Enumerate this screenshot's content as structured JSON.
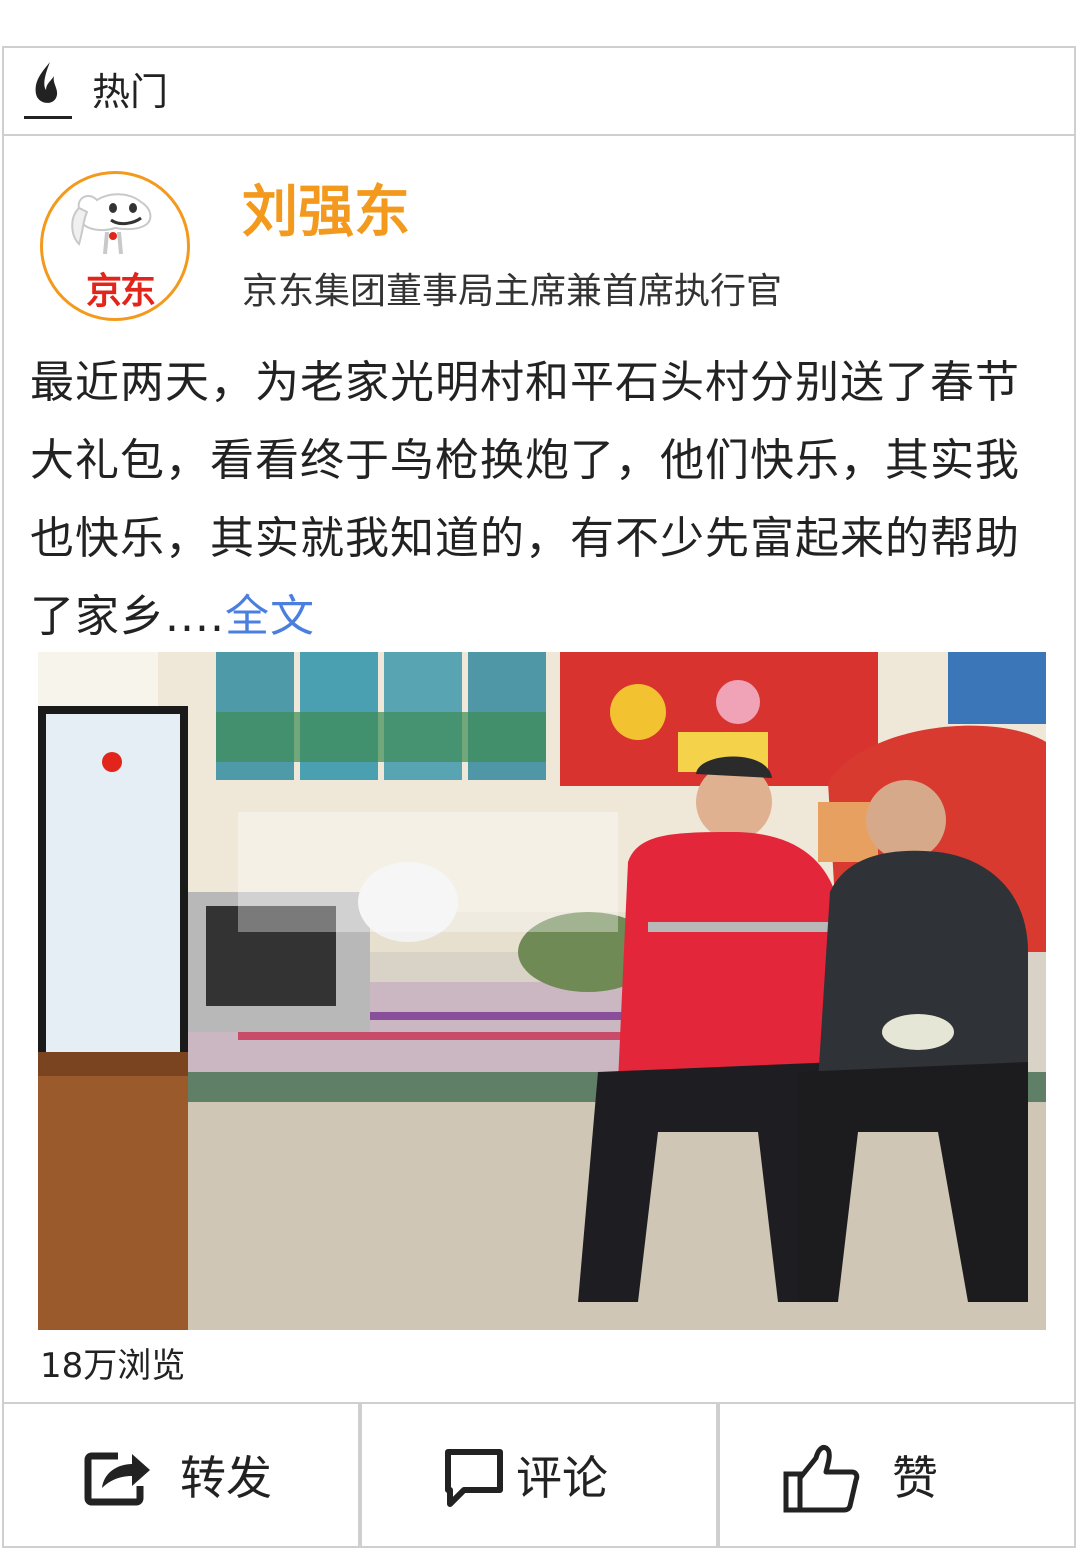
{
  "section": {
    "label": "热门",
    "icon": "flame-icon"
  },
  "post": {
    "author": {
      "name": "刘强东",
      "title": "京东集团董事局主席兼首席执行官",
      "avatar_text": "京东"
    },
    "text": "最近两天，为老家光明村和平石头村分别送了春节大礼包，看看终于鸟枪换炮了，他们快乐，其实我也快乐，其实就我知道的，有不少先富起来的帮助了家乡....",
    "full_link": "全文",
    "views": "18万浏览"
  },
  "actions": [
    {
      "label": "转发",
      "icon": "share-icon"
    },
    {
      "label": "评论",
      "icon": "comment-icon"
    },
    {
      "label": "赞",
      "icon": "thumbs-up-icon"
    }
  ],
  "colors": {
    "accent": "#f39a1e",
    "link": "#4a7fe0",
    "border": "#cfcfcf",
    "logo_red": "#e1251b"
  }
}
